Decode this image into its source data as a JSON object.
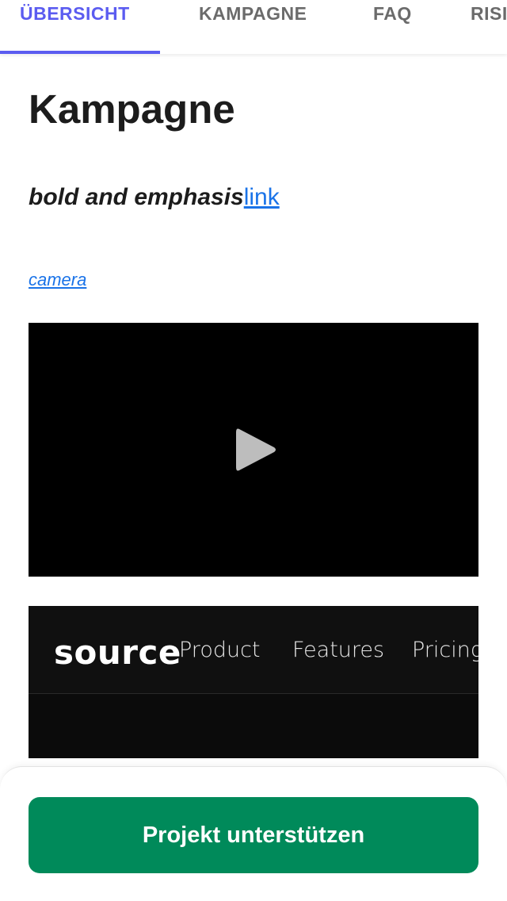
{
  "tabs": {
    "overview": "ÜBERSICHT",
    "campaign": "KAMPAGNE",
    "faq": "FAQ",
    "risks": "RISI"
  },
  "content": {
    "heading": "Kampagne",
    "emphasis_text": "bold and emphasis",
    "link_text": "link",
    "camera_link": "camera"
  },
  "video": {
    "icon": "play-icon"
  },
  "embed": {
    "logo": "source",
    "nav": [
      "Product",
      "Features",
      "Pricing"
    ]
  },
  "cta": {
    "label": "Projekt unterstützen"
  },
  "colors": {
    "accent": "#5b5cf0",
    "link": "#1a73e8",
    "cta": "#008a5a"
  }
}
